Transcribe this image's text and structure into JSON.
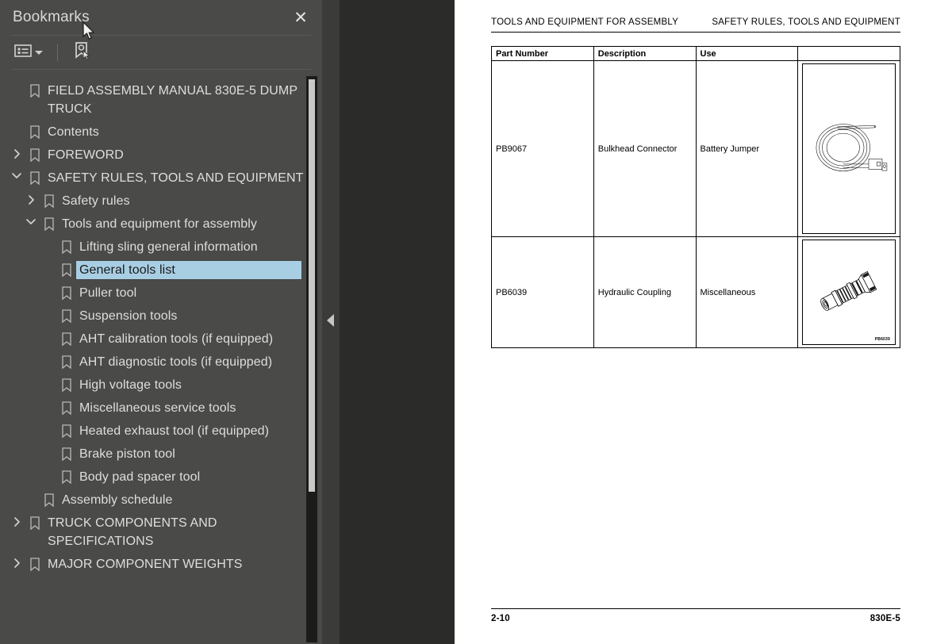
{
  "sidebar": {
    "title": "Bookmarks",
    "close_label": "✕",
    "toolbar": {
      "options_icon": "list-options-icon",
      "dropdown_icon": "chevron-down-icon",
      "new_bookmark_icon": "new-bookmark-icon"
    },
    "selection_bg": "#a8cee3",
    "background": "#4a4a48",
    "items": [
      {
        "label": "FIELD ASSEMBLY MANUAL 830E-5  DUMP TRUCK",
        "level": 0,
        "twisty": "none",
        "selected": false
      },
      {
        "label": "Contents",
        "level": 0,
        "twisty": "none",
        "selected": false
      },
      {
        "label": "FOREWORD",
        "level": 0,
        "twisty": "collapsed",
        "selected": false
      },
      {
        "label": "SAFETY RULES, TOOLS AND EQUIPMENT",
        "level": 0,
        "twisty": "expanded",
        "selected": false
      },
      {
        "label": "Safety rules",
        "level": 1,
        "twisty": "collapsed",
        "selected": false
      },
      {
        "label": "Tools and equipment for assembly",
        "level": 1,
        "twisty": "expanded",
        "selected": false
      },
      {
        "label": "Lifting sling general information",
        "level": 2,
        "twisty": "none",
        "selected": false
      },
      {
        "label": "General tools list",
        "level": 2,
        "twisty": "none",
        "selected": true
      },
      {
        "label": "Puller tool",
        "level": 2,
        "twisty": "none",
        "selected": false
      },
      {
        "label": "Suspension tools",
        "level": 2,
        "twisty": "none",
        "selected": false
      },
      {
        "label": "AHT calibration tools (if equipped)",
        "level": 2,
        "twisty": "none",
        "selected": false
      },
      {
        "label": "AHT diagnostic tools (if equipped)",
        "level": 2,
        "twisty": "none",
        "selected": false
      },
      {
        "label": "High voltage tools",
        "level": 2,
        "twisty": "none",
        "selected": false
      },
      {
        "label": "Miscellaneous service tools",
        "level": 2,
        "twisty": "none",
        "selected": false
      },
      {
        "label": "Heated exhaust tool (if equipped)",
        "level": 2,
        "twisty": "none",
        "selected": false
      },
      {
        "label": "Brake piston tool",
        "level": 2,
        "twisty": "none",
        "selected": false
      },
      {
        "label": "Body pad spacer tool",
        "level": 2,
        "twisty": "none",
        "selected": false
      },
      {
        "label": "Assembly schedule",
        "level": 1,
        "twisty": "none",
        "selected": false
      },
      {
        "label": "TRUCK COMPONENTS AND SPECIFICATIONS",
        "level": 0,
        "twisty": "collapsed",
        "selected": false
      },
      {
        "label": "MAJOR COMPONENT WEIGHTS",
        "level": 0,
        "twisty": "collapsed",
        "selected": false
      }
    ]
  },
  "gutter": {
    "collapse_icon": "collapse-panel-icon"
  },
  "page": {
    "header_left": "TOOLS AND EQUIPMENT FOR ASSEMBLY",
    "header_right": "SAFETY RULES, TOOLS AND EQUIPMENT",
    "table": {
      "columns": [
        "Part Number",
        "Description",
        "Use",
        ""
      ],
      "rows": [
        {
          "part_number": "PB9067",
          "description": "Bulkhead Connector",
          "use": "Battery Jumper",
          "image": "coiled-cable-illustration",
          "image_caption": ""
        },
        {
          "part_number": "PB6039",
          "description": "Hydraulic Coupling",
          "use": "Miscellaneous",
          "image": "hydraulic-coupling-illustration",
          "image_caption": "PB6039"
        }
      ]
    },
    "footer_left": "2-10",
    "footer_right": "830E-5"
  }
}
